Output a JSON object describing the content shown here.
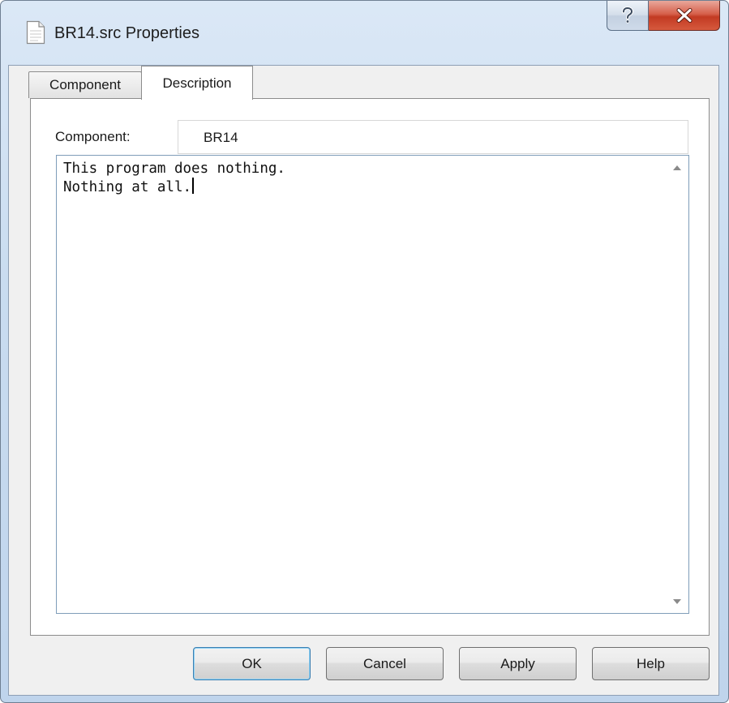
{
  "window": {
    "title": "BR14.src Properties",
    "help_icon": "question-mark-icon",
    "close_icon": "close-icon",
    "doc_icon": "document-icon"
  },
  "tabs": [
    {
      "label": "Component",
      "active": false
    },
    {
      "label": "Description",
      "active": true
    }
  ],
  "description_tab": {
    "component_label": "Component:",
    "component_value": "BR14",
    "description_lines": [
      "This program does nothing.",
      "Nothing at all."
    ]
  },
  "buttons": {
    "ok": "OK",
    "cancel": "Cancel",
    "apply": "Apply",
    "help": "Help"
  },
  "colors": {
    "close_button": "#c23a22",
    "default_button_border": "#3c7fb1"
  }
}
